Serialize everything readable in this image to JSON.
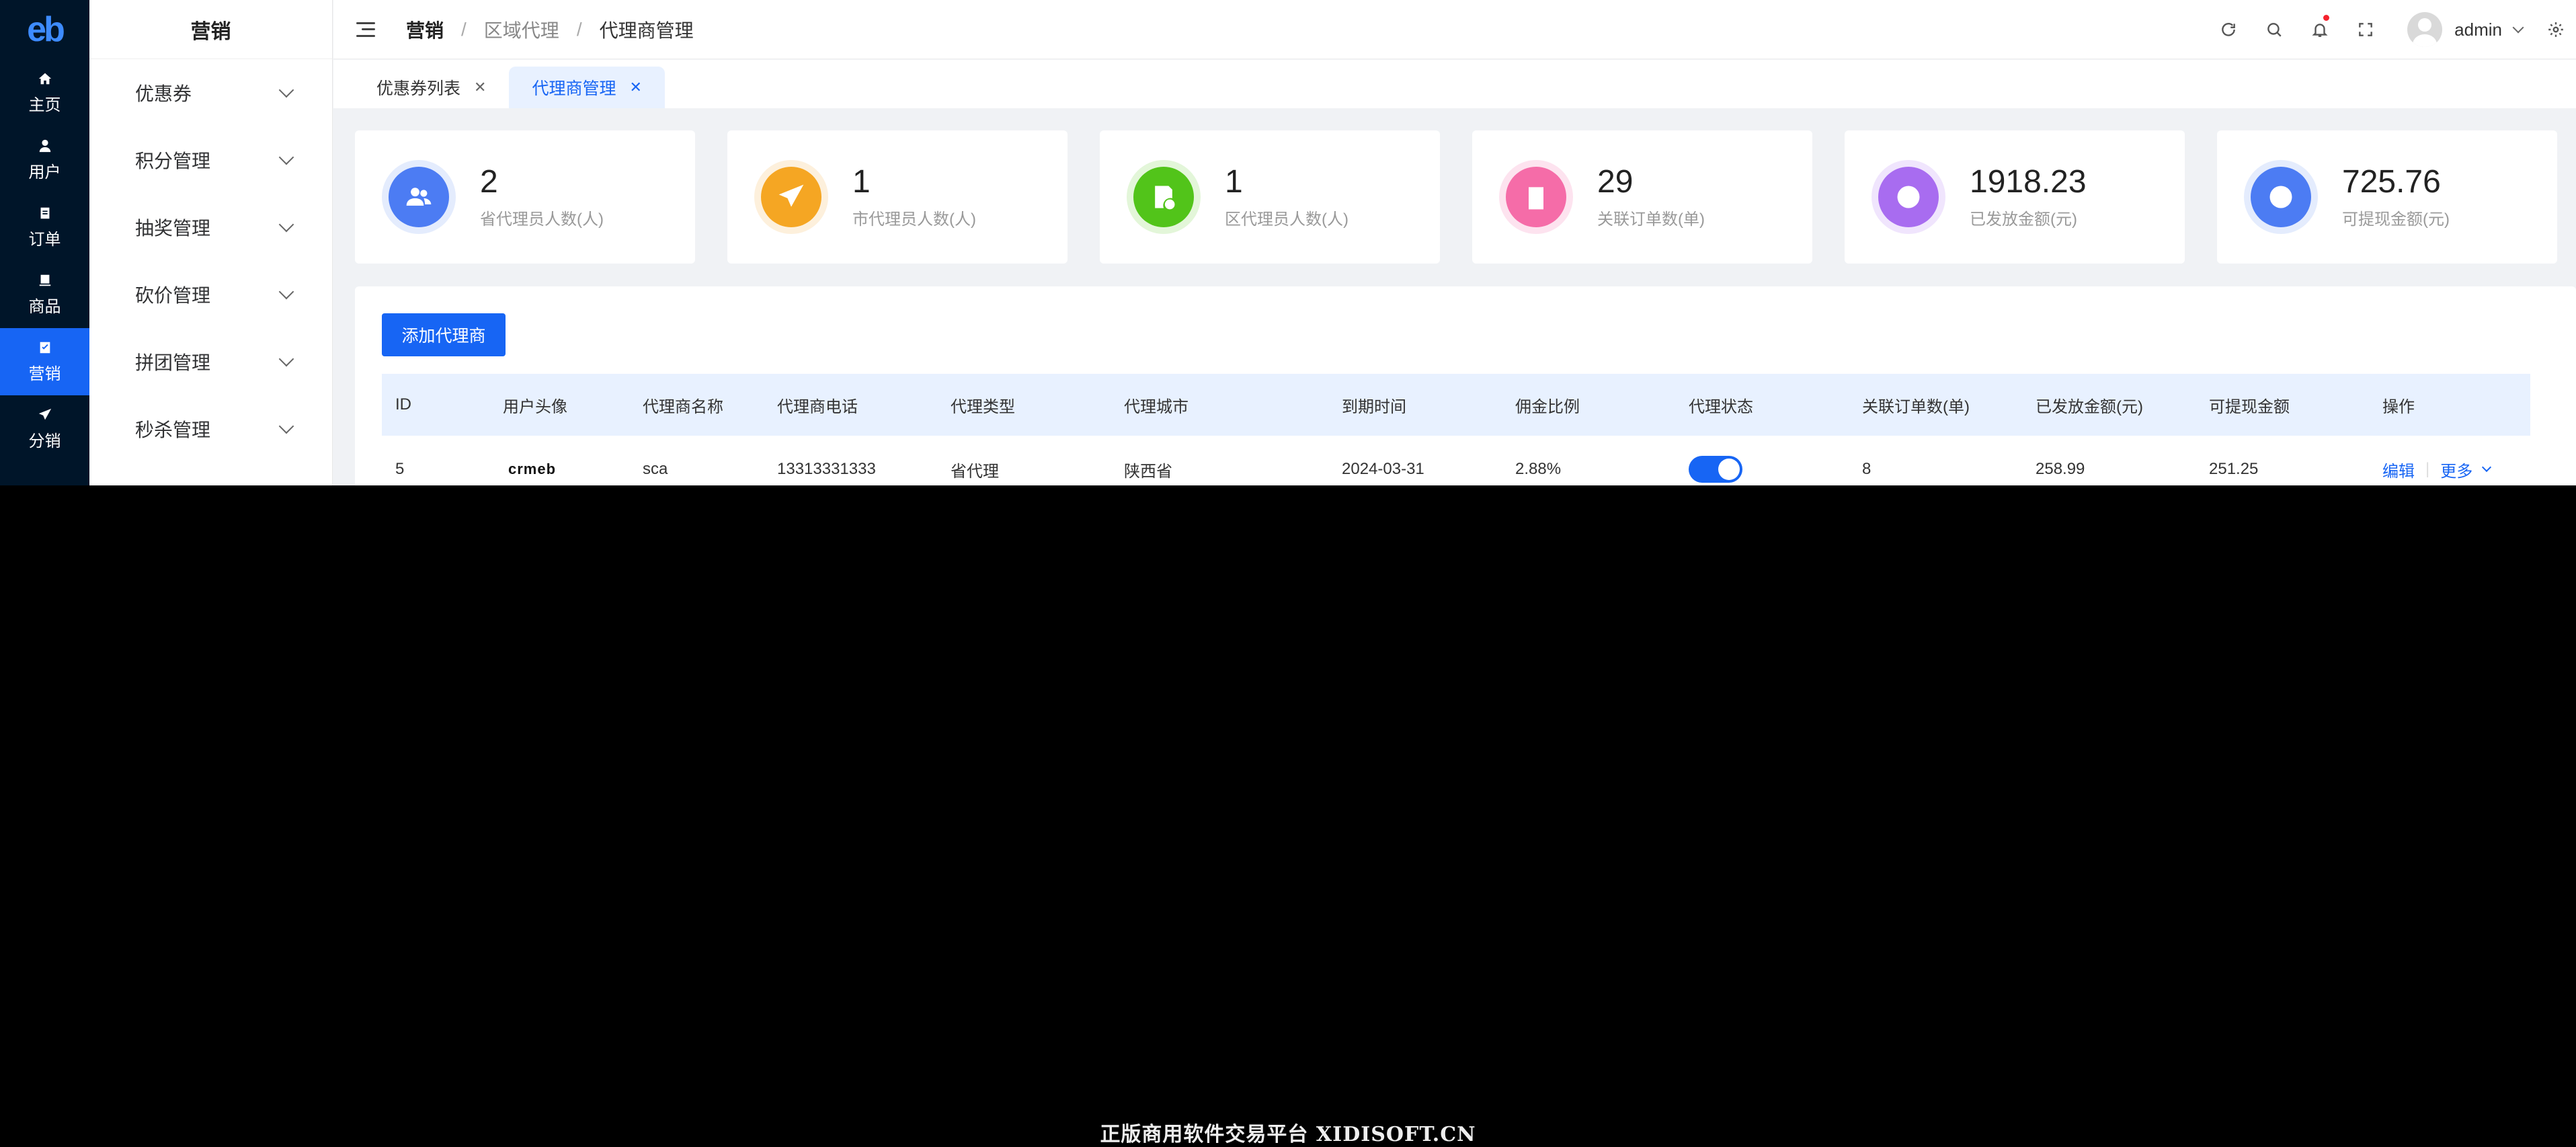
{
  "rail": {
    "logo": "eb",
    "items": [
      {
        "label": "主页",
        "icon": "home-icon"
      },
      {
        "label": "用户",
        "icon": "user-icon"
      },
      {
        "label": "订单",
        "icon": "order-icon"
      },
      {
        "label": "商品",
        "icon": "goods-icon"
      },
      {
        "label": "营销",
        "icon": "marketing-icon",
        "active": true
      },
      {
        "label": "分销",
        "icon": "distribution-icon"
      }
    ]
  },
  "submenu": {
    "title": "营销",
    "items": [
      "优惠券",
      "积分管理",
      "抽奖管理",
      "砍价管理",
      "拼团管理",
      "秒杀管理"
    ]
  },
  "header": {
    "breadcrumb": [
      "营销",
      "区域代理",
      "代理商管理"
    ],
    "separator": "/",
    "username": "admin"
  },
  "tabs": [
    {
      "label": "优惠券列表",
      "close": "✕"
    },
    {
      "label": "代理商管理",
      "close": "✕",
      "active": true
    }
  ],
  "stats": [
    {
      "value": "2",
      "label": "省代理员人数(人)",
      "icon": "users-icon",
      "color": "#4c7cf3",
      "ring": "#e4ecfd"
    },
    {
      "value": "1",
      "label": "市代理员人数(人)",
      "icon": "paper-plane-icon",
      "color": "#f5a623",
      "ring": "#fdf0dc"
    },
    {
      "value": "1",
      "label": "区代理员人数(人)",
      "icon": "document-add-icon",
      "color": "#52c41a",
      "ring": "#e3f6d9"
    },
    {
      "value": "29",
      "label": "关联订单数(单)",
      "icon": "clipboard-icon",
      "color": "#f56ca8",
      "ring": "#fde3ef"
    },
    {
      "value": "1918.23",
      "label": "已发放金额(元)",
      "icon": "yuan-coin-icon",
      "color": "#a86cf0",
      "ring": "#f0e5fd"
    },
    {
      "value": "725.76",
      "label": "可提现金额(元)",
      "icon": "yuan-refresh-icon",
      "color": "#4c7cf3",
      "ring": "#e4ecfd"
    }
  ],
  "table": {
    "add_button": "添加代理商",
    "columns": [
      "ID",
      "用户头像",
      "代理商名称",
      "代理商电话",
      "代理类型",
      "代理城市",
      "到期时间",
      "佣金比例",
      "代理状态",
      "关联订单数(单)",
      "已发放金额(元)",
      "可提现金额",
      "操作"
    ],
    "rows": [
      {
        "id": "5",
        "avatar_text": "crmeb",
        "name": "sca",
        "phone": "13313331333",
        "type": "省代理",
        "city": "陕西省",
        "expire": "2024-03-31",
        "commission": "2.88%",
        "status_on": true,
        "orders": "8",
        "paid": "258.99",
        "withdrawable": "251.25",
        "edit": "编辑",
        "more": "更多"
      }
    ]
  },
  "watermark": "正版商用软件交易平台 XIDISOFT.CN"
}
